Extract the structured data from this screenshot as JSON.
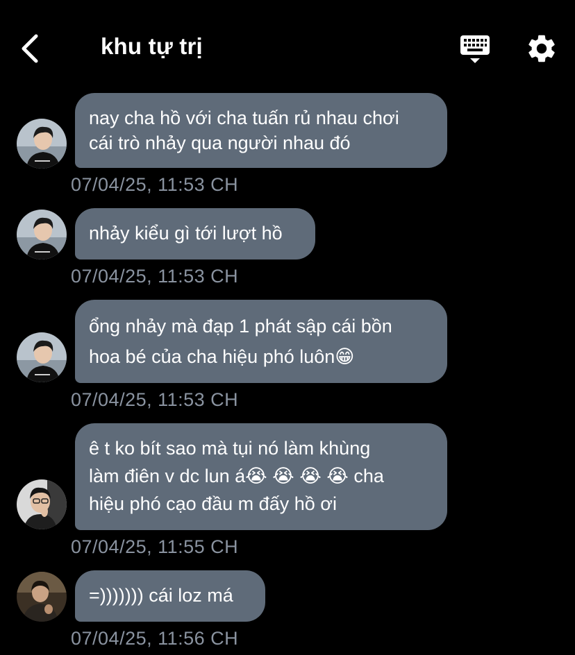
{
  "header": {
    "title": "khu tự trị"
  },
  "colors": {
    "background": "#000000",
    "bubble": "#5f6b79",
    "timestamp": "#8a93a0"
  },
  "messages": [
    {
      "text": "nay cha hồ với cha tuấn rủ nhau chơi\ncái trò nhảy qua người nhau đó",
      "time": "07/04/25, 11:53 CH",
      "avatar": "avatar-boy-white-shirt"
    },
    {
      "text": "nhảy kiểu gì tới lượt hồ",
      "time": "07/04/25, 11:53 CH",
      "avatar": "avatar-boy-white-shirt"
    },
    {
      "text": "ổng nhảy mà đạp 1 phát sập cái bồn\nhoa bé của cha hiệu phó luôn😁",
      "time": "07/04/25, 11:53 CH",
      "avatar": "avatar-boy-white-shirt"
    },
    {
      "text": "ê t ko bít sao mà tụi nó làm khùng\nlàm điên v dc lun á😭 😭 😭 😭 cha\nhiệu phó cạo đầu m đấy hồ ơi",
      "time": "07/04/25, 11:55 CH",
      "avatar": "avatar-boy-glasses"
    },
    {
      "text": "=))))))) cái loz má",
      "time": "07/04/25, 11:56 CH",
      "avatar": "avatar-boy-dark"
    }
  ]
}
